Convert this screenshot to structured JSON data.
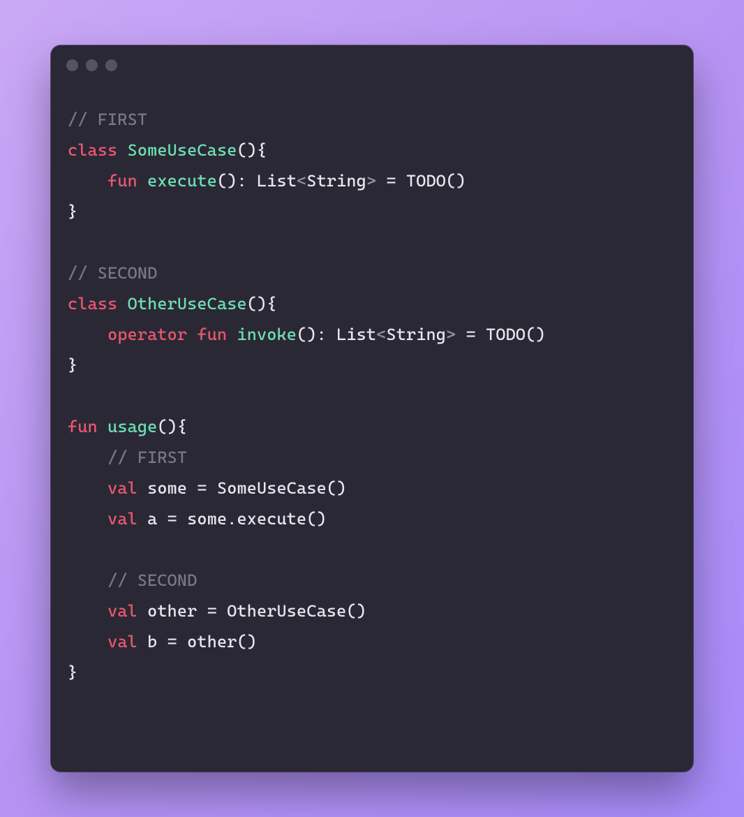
{
  "code": {
    "l1": {
      "comment": "// FIRST"
    },
    "l2": {
      "kw_class": "class",
      "type": "SomeUseCase",
      "after": "(){"
    },
    "l3": {
      "indent": "    ",
      "kw_fun": "fun",
      "fn": "execute",
      "parens": "()",
      "colon": ": ",
      "list_t": "List",
      "lt": "<",
      "str_t": "String",
      "gt": ">",
      "eq_todo": " = TODO()"
    },
    "l4": {
      "brace": "}"
    },
    "l5": {
      "blank": ""
    },
    "l6": {
      "comment": "// SECOND"
    },
    "l7": {
      "kw_class": "class",
      "type": "OtherUseCase",
      "after": "(){"
    },
    "l8": {
      "indent": "    ",
      "kw_operator": "operator",
      "kw_fun": "fun",
      "fn": "invoke",
      "parens": "()",
      "colon": ": ",
      "list_t": "List",
      "lt": "<",
      "str_t": "String",
      "gt": ">",
      "eq_todo": " = TODO()"
    },
    "l9": {
      "brace": "}"
    },
    "l10": {
      "blank": ""
    },
    "l11": {
      "kw_fun": "fun",
      "fn": "usage",
      "after": "(){"
    },
    "l12": {
      "indent": "    ",
      "comment": "// FIRST"
    },
    "l13": {
      "indent": "    ",
      "kw_val": "val",
      "rest": " some = SomeUseCase()"
    },
    "l14": {
      "indent": "    ",
      "kw_val": "val",
      "rest": " a = some.execute()"
    },
    "l15": {
      "blank": ""
    },
    "l16": {
      "indent": "    ",
      "comment": "// SECOND"
    },
    "l17": {
      "indent": "    ",
      "kw_val": "val",
      "rest": " other = OtherUseCase()"
    },
    "l18": {
      "indent": "    ",
      "kw_val": "val",
      "rest": " b = other()"
    },
    "l19": {
      "brace": "}"
    }
  }
}
